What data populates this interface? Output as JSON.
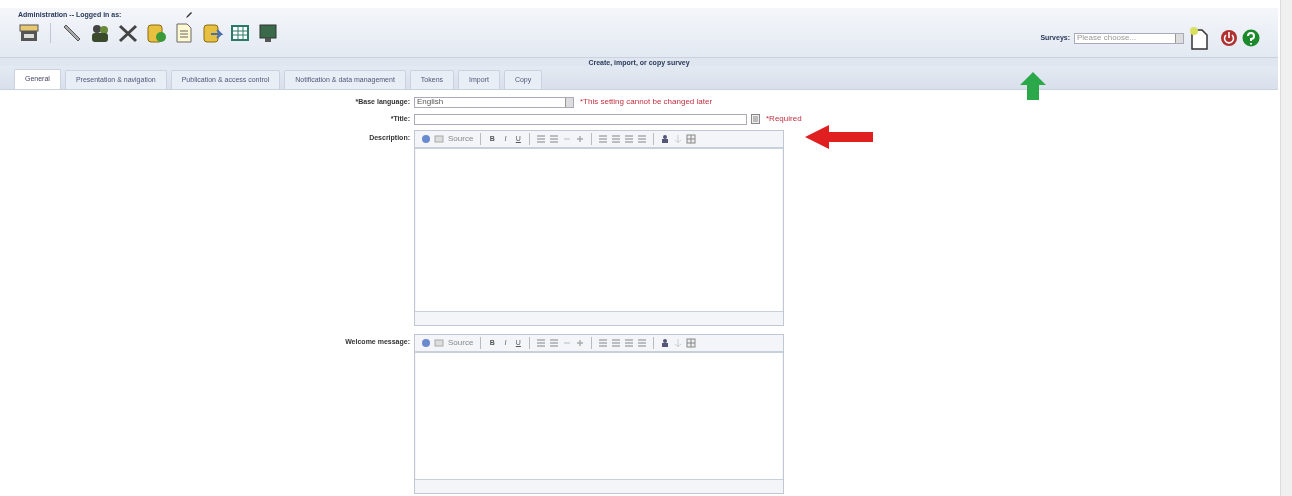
{
  "header": {
    "login_label": "Administration -- Logged in as:",
    "surveys_label": "Surveys:",
    "surveys_select": {
      "value": "Please choose..."
    }
  },
  "title_bar": "Create, import, or copy survey",
  "tabs": [
    {
      "label": "General",
      "selected": true
    },
    {
      "label": "Presentation & navigation",
      "selected": false
    },
    {
      "label": "Publication & access control",
      "selected": false
    },
    {
      "label": "Notification & data management",
      "selected": false
    },
    {
      "label": "Tokens",
      "selected": false
    },
    {
      "label": "Import",
      "selected": false
    },
    {
      "label": "Copy",
      "selected": false
    }
  ],
  "form": {
    "base_language": {
      "label": "*Base language:",
      "value": "English",
      "note": "*This setting cannot be changed later"
    },
    "title": {
      "label": "*Title:",
      "note": "*Required"
    },
    "editors": [
      {
        "label": "Description:",
        "toolbar": {
          "source": "Source",
          "bold": "B",
          "italic": "I",
          "underline": "U"
        }
      },
      {
        "label": "Welcome message:",
        "toolbar": {
          "source": "Source",
          "bold": "B",
          "italic": "I",
          "underline": "U"
        }
      }
    ]
  }
}
